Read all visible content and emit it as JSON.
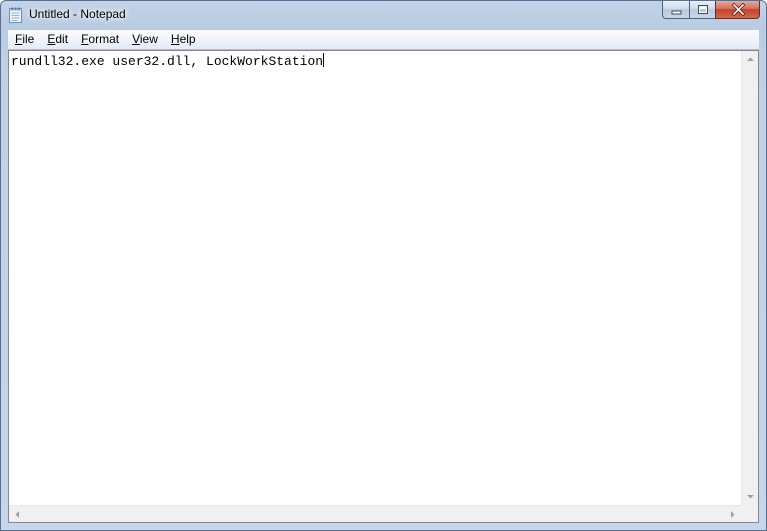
{
  "window": {
    "title": "Untitled - Notepad",
    "app_icon": "notepad-icon",
    "caption_buttons": {
      "minimize_icon": "minimize-icon",
      "maximize_icon": "maximize-icon",
      "close_icon": "close-icon"
    }
  },
  "menu": {
    "items": [
      {
        "accel": "F",
        "rest": "ile"
      },
      {
        "accel": "E",
        "rest": "dit"
      },
      {
        "accel": "F",
        "rest": "ormat"
      },
      {
        "accel": "V",
        "rest": "iew"
      },
      {
        "accel": "H",
        "rest": "elp"
      }
    ]
  },
  "editor": {
    "content": "rundll32.exe user32.dll, LockWorkStation"
  },
  "scrollbars": {
    "up_icon": "scroll-up-arrow-icon",
    "down_icon": "scroll-down-arrow-icon",
    "left_icon": "scroll-left-arrow-icon",
    "right_icon": "scroll-right-arrow-icon"
  },
  "colors": {
    "title_bar": "#b8cbe2",
    "close_button": "#c4412a",
    "menu_bar": "#eef3fa",
    "editor_bg": "#ffffff"
  }
}
